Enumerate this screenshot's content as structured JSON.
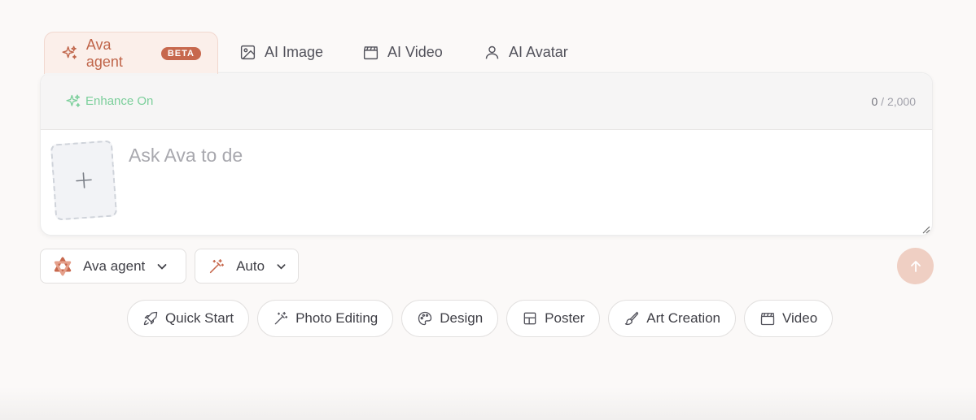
{
  "tabs": [
    {
      "label": "Ava agent",
      "badge": "BETA",
      "icon": "sparkle-icon",
      "active": true
    },
    {
      "label": "AI Image",
      "icon": "image-icon"
    },
    {
      "label": "AI Video",
      "icon": "clapperboard-icon"
    },
    {
      "label": "AI Avatar",
      "icon": "user-icon"
    }
  ],
  "prompt": {
    "enhance_label": "Enhance On",
    "counter_current": "0",
    "counter_max": " / 2,000",
    "placeholder": "Ask Ava to de"
  },
  "controls": {
    "agent_label": "Ava agent",
    "mode_label": "Auto"
  },
  "chips": [
    {
      "label": "Quick Start",
      "icon": "rocket-icon"
    },
    {
      "label": "Photo Editing",
      "icon": "magic-wand-icon"
    },
    {
      "label": "Design",
      "icon": "palette-icon"
    },
    {
      "label": "Poster",
      "icon": "layout-icon"
    },
    {
      "label": "Art Creation",
      "icon": "brush-icon"
    },
    {
      "label": "Video",
      "icon": "clapperboard-icon"
    }
  ],
  "colors": {
    "accent": "#c7684d",
    "enhance": "#7ccf9b",
    "send": "#efcfc3"
  }
}
